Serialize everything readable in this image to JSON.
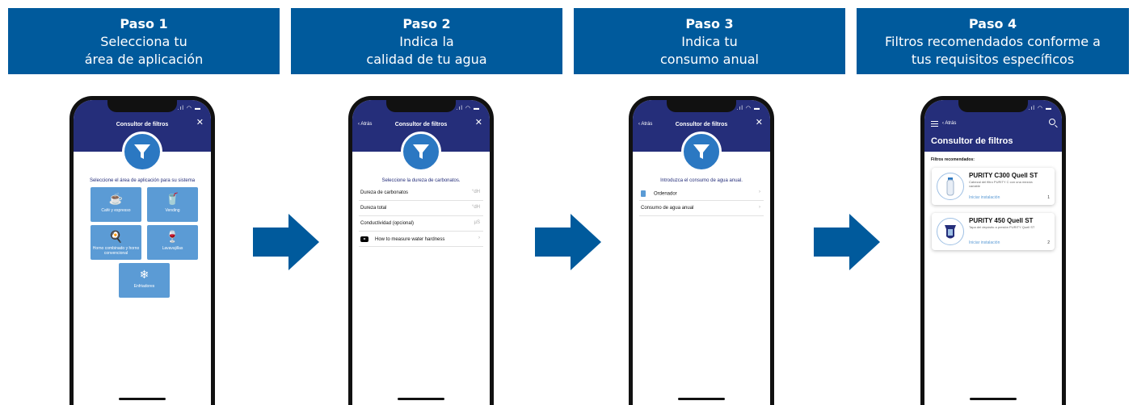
{
  "steps": [
    {
      "title": "Paso 1",
      "line1": "Selecciona tu",
      "line2": "área de aplicación"
    },
    {
      "title": "Paso 2",
      "line1": "Indica la",
      "line2": "calidad de tu agua"
    },
    {
      "title": "Paso 3",
      "line1": "Indica tu",
      "line2": "consumo anual"
    },
    {
      "title": "Paso 4",
      "line1": "Filtros recomendados conforme a",
      "line2": "tus requisitos específicos"
    }
  ],
  "colors": {
    "header": "#005a9c",
    "navbar": "#252e7a",
    "tile": "#5b9bd5"
  },
  "screen1": {
    "nav_title": "Consultor de filtros",
    "close": "✕",
    "prompt": "Seleccione el área de aplicación para su sistema",
    "tiles": [
      {
        "label": "Café y espresso",
        "icon": "coffee-cup-icon",
        "glyph": "☕"
      },
      {
        "label": "Vending",
        "icon": "vending-cup-icon",
        "glyph": "🥤"
      },
      {
        "label": "Horno combinado y horno convencional",
        "icon": "oven-icon",
        "glyph": "🍳"
      },
      {
        "label": "Lavavajillas",
        "icon": "wineglass-icon",
        "glyph": "🍷"
      },
      {
        "label": "Enfriadores",
        "icon": "snowflake-icon",
        "glyph": "❄"
      }
    ]
  },
  "screen2": {
    "nav_back": "‹ Atrás",
    "nav_title": "Consultor de filtros",
    "close": "✕",
    "prompt": "Seleccione la dureza de carbonatos.",
    "rows": [
      {
        "label": "Dureza de carbonatos",
        "unit": "°dH"
      },
      {
        "label": "Dureza total",
        "unit": "°dH"
      },
      {
        "label": "Conductividad (opcional)",
        "unit": "µS"
      },
      {
        "label": "How to measure water hardness",
        "unit": "›"
      }
    ]
  },
  "screen3": {
    "nav_back": "‹ Atrás",
    "nav_title": "Consultor de filtros",
    "close": "✕",
    "prompt": "Introduzca el consumo de agua anual.",
    "rows": [
      {
        "label": "Ordenador",
        "unit": "›"
      },
      {
        "label": "Consumo de agua anual",
        "unit": "›"
      }
    ]
  },
  "screen4": {
    "nav_back": "‹ Atrás",
    "title": "Consultor de filtros",
    "subtitle": "Filtros recomendados:",
    "cards": [
      {
        "name": "PURITY C300 Quell ST",
        "desc": "Cabezal del filtro PURITY C con una mezcla variable",
        "cta": "Iniciar instalación",
        "num": "1"
      },
      {
        "name": "PURITY 450 Quell ST",
        "desc": "Tapa del depósito a presión PURITY Quell ST",
        "cta": "Iniciar instalación",
        "num": "2"
      }
    ]
  }
}
